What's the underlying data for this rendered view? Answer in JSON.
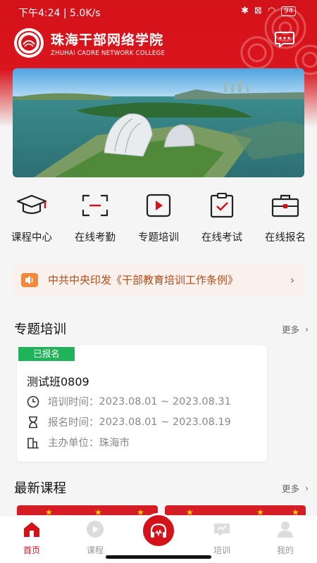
{
  "status_bar": {
    "time": "下午4:24 | 5.0K/s",
    "battery": "94"
  },
  "brand": {
    "name": "珠海干部网络学院",
    "english": "ZHUHAI CADRE NETWORK COLLEGE"
  },
  "quick_nav": [
    {
      "label": "课程中心",
      "icon": "mortarboard-icon"
    },
    {
      "label": "在线考勤",
      "icon": "scan-icon"
    },
    {
      "label": "专题培训",
      "icon": "play-icon"
    },
    {
      "label": "在线考试",
      "icon": "clipboard-check-icon"
    },
    {
      "label": "在线报名",
      "icon": "briefcase-icon"
    }
  ],
  "notice": {
    "text": "中共中央印发《干部教育培训工作条例》"
  },
  "special_training": {
    "title": "专题培训",
    "more": "更多",
    "card": {
      "tag": "已报名",
      "name": "测试班0809",
      "train_time_label": "培训时间：",
      "train_time": "2023.08.01 ~ 2023.08.31",
      "signup_time_label": "报名时间：",
      "signup_time": "2023.08.01 ~ 2023.08.19",
      "host_label": "主办单位：",
      "host": "珠海市"
    }
  },
  "latest_courses": {
    "title": "最新课程",
    "more": "更多"
  },
  "tabbar": [
    {
      "label": "首页",
      "active": true
    },
    {
      "label": "课程",
      "active": false
    },
    {
      "label": "",
      "active": false
    },
    {
      "label": "培训",
      "active": false
    },
    {
      "label": "我的",
      "active": false
    }
  ],
  "colors": {
    "brand_red": "#d4121a",
    "tag_green": "#21b35a",
    "notice_text": "#b44b1b"
  }
}
